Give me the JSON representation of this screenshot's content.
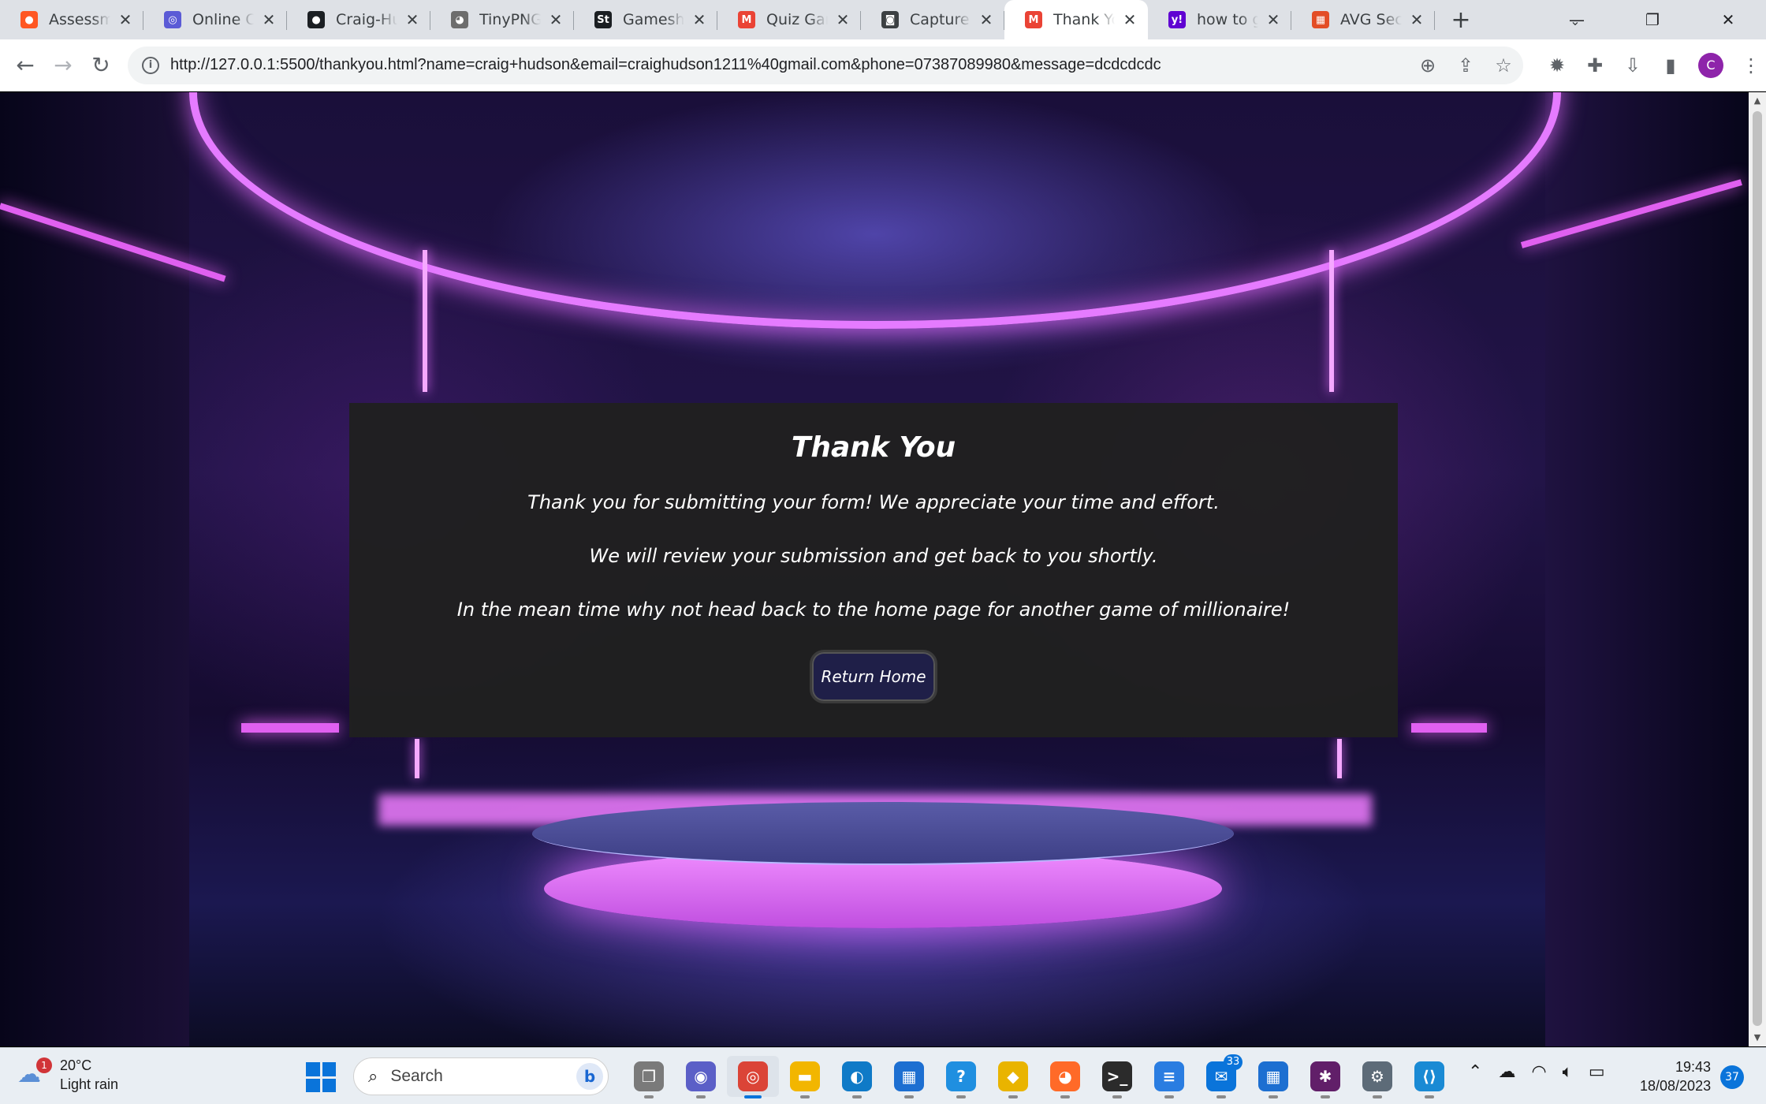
{
  "browser": {
    "tabs": [
      {
        "title": "Assessment",
        "icon": "record-icon",
        "color": "#ff5722",
        "glyph": "●",
        "active": false
      },
      {
        "title": "Online Con",
        "icon": "circle-logo-icon",
        "color": "#5b5bd6",
        "glyph": "◎",
        "active": false
      },
      {
        "title": "Craig-Hud",
        "icon": "github-icon",
        "color": "#1b1f23",
        "glyph": "●",
        "active": false
      },
      {
        "title": "TinyPNG –",
        "icon": "panda-icon",
        "color": "#6d6d6d",
        "glyph": "◕",
        "active": false
      },
      {
        "title": "Gameshow",
        "icon": "st-logo-icon",
        "color": "#1b1f23",
        "glyph": "St",
        "active": false
      },
      {
        "title": "Quiz Game",
        "icon": "gmail-icon",
        "color": "#ea4335",
        "glyph": "M",
        "active": false
      },
      {
        "title": "Capture Ph",
        "icon": "camera-icon",
        "color": "#3c4043",
        "glyph": "◙",
        "active": false
      },
      {
        "title": "Thank You",
        "icon": "gmail-icon",
        "color": "#ea4335",
        "glyph": "M",
        "active": true
      },
      {
        "title": "how to go",
        "icon": "yahoo-icon",
        "color": "#6001d2",
        "glyph": "y!",
        "active": false
      },
      {
        "title": "AVG Secur",
        "icon": "avg-icon",
        "color": "#e34d26",
        "glyph": "▦",
        "active": false
      }
    ],
    "new_tab_label": "+",
    "url": "http://127.0.0.1:5500/thankyou.html?name=craig+hudson&email=craighudson1211%40gmail.com&phone=07387089980&message=dcdcdcdc",
    "profile_initial": "C"
  },
  "page": {
    "title": "Thank You",
    "line1": "Thank you for submitting your form! We appreciate your time and effort.",
    "line2": "We will review your submission and get back to you shortly.",
    "line3": "In the mean time why not head back to the home page for another game of millionaire!",
    "button_label": "Return Home"
  },
  "taskbar": {
    "weather_temp": "20°C",
    "weather_desc": "Light rain",
    "weather_badge": "1",
    "search_placeholder": "Search",
    "apps": [
      {
        "name": "task-view-icon",
        "glyph": "❐",
        "color": "#7a7a7a",
        "active": false
      },
      {
        "name": "teams-chat-icon",
        "glyph": "◉",
        "color": "#5b5fc7",
        "active": false
      },
      {
        "name": "chrome-icon",
        "glyph": "◎",
        "color": "#db4437",
        "active": true
      },
      {
        "name": "file-explorer-icon",
        "glyph": "▬",
        "color": "#f2b600",
        "active": false
      },
      {
        "name": "edge-icon",
        "glyph": "◐",
        "color": "#0f7ac7",
        "active": false
      },
      {
        "name": "store-icon",
        "glyph": "▦",
        "color": "#1d6fd1",
        "active": false
      },
      {
        "name": "help-icon",
        "glyph": "?",
        "color": "#1f8fe0",
        "active": false
      },
      {
        "name": "maps-icon",
        "glyph": "◆",
        "color": "#e9b400",
        "active": false
      },
      {
        "name": "firefox-icon",
        "glyph": "◕",
        "color": "#ff6a28",
        "active": false
      },
      {
        "name": "terminal-icon",
        "glyph": ">_",
        "color": "#2b2b2b",
        "active": false
      },
      {
        "name": "notepad-icon",
        "glyph": "≡",
        "color": "#2a7de1",
        "active": false
      },
      {
        "name": "mail-icon",
        "glyph": "✉",
        "color": "#0a74da",
        "active": false,
        "count": "33"
      },
      {
        "name": "calendar-icon",
        "glyph": "▦",
        "color": "#1d6fd1",
        "active": false
      },
      {
        "name": "slack-icon",
        "glyph": "✱",
        "color": "#611f69",
        "active": false
      },
      {
        "name": "settings-icon",
        "glyph": "⚙",
        "color": "#5d6b78",
        "active": false
      },
      {
        "name": "vscode-icon",
        "glyph": "⟨⟩",
        "color": "#1a8ad4",
        "active": false
      }
    ],
    "time": "19:43",
    "date": "18/08/2023",
    "notification_count": "37"
  }
}
